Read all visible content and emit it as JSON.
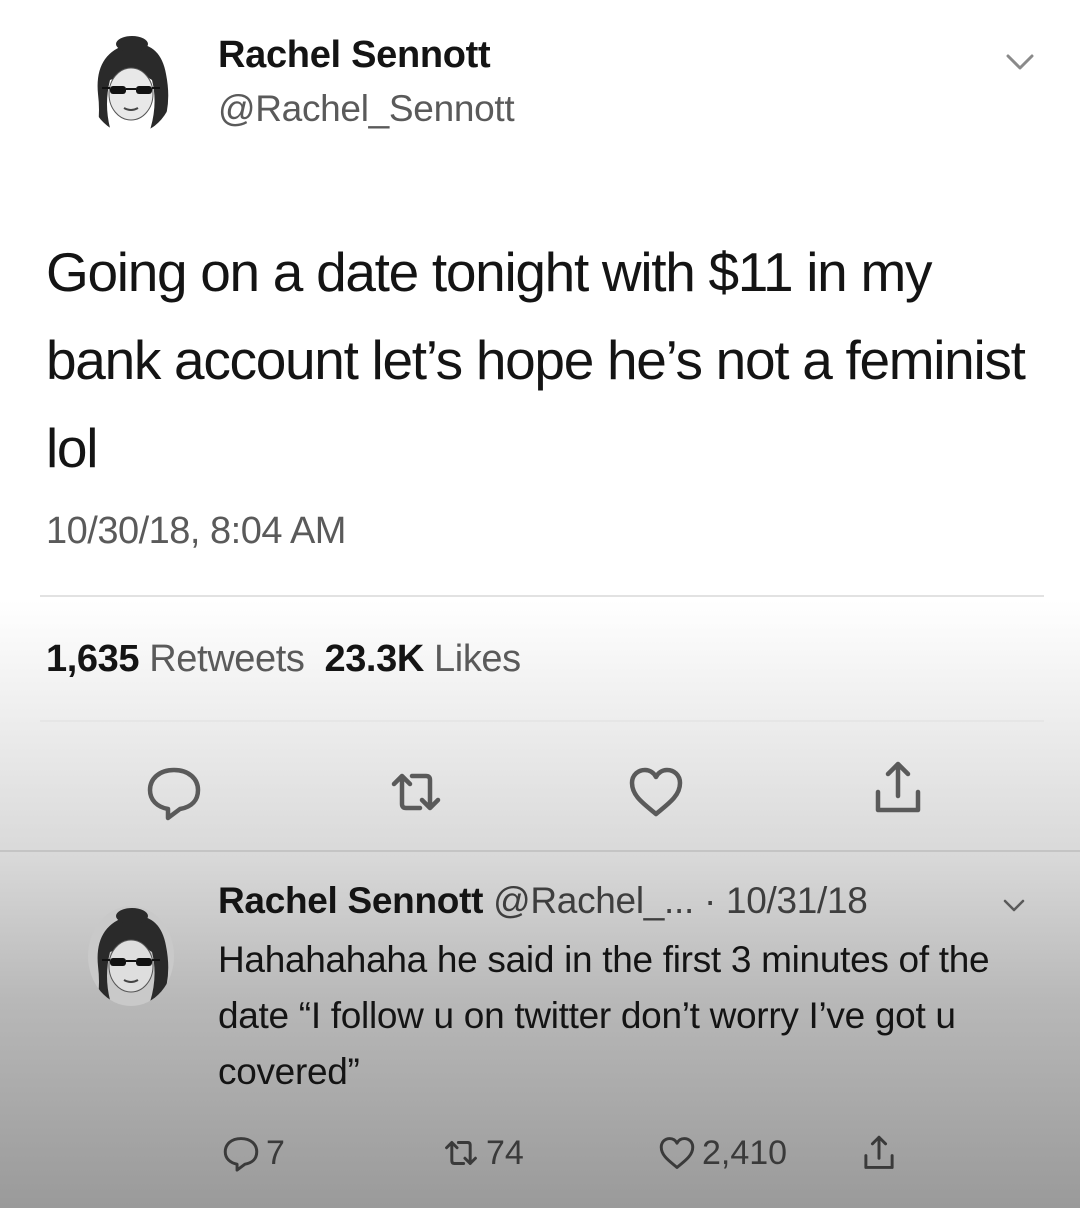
{
  "tweet": {
    "author_name": "Rachel Sennott",
    "author_handle": "@Rachel_Sennott",
    "text": "Going on a date tonight with $11 in my bank account let’s hope he’s not a feminist lol",
    "timestamp": "10/30/18, 8:04 AM",
    "retweets_count": "1,635",
    "retweets_label": "Retweets",
    "likes_count": "23.3K",
    "likes_label": "Likes",
    "actions": [
      "reply-icon",
      "retweet-icon",
      "heart-icon",
      "share-icon"
    ]
  },
  "reply": {
    "author_name": "Rachel Sennott",
    "meta": "@Rachel_... · 10/31/18",
    "text": "Hahahahaha he said in the first 3 minutes of the date “I follow u on twitter don’t worry I’ve got u covered”",
    "reply_count": "7",
    "retweet_count": "74",
    "like_count": "2,410"
  },
  "colors": {
    "text": "#141414",
    "secondary_text": "#5a5a5a",
    "divider": "#e2e2e2"
  }
}
